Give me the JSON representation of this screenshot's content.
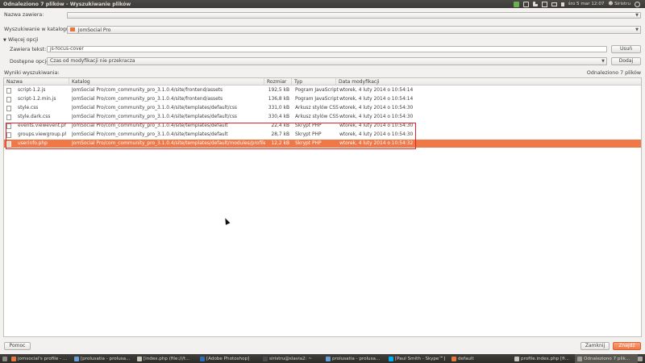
{
  "window": {
    "title": "Odnaleziono 7 plików - Wyszukiwanie plików"
  },
  "tray": {
    "clock": "śro 5 mar 12:07",
    "user": "Siristru"
  },
  "search": {
    "name_label": "Nazwa zawiera:",
    "name_value": "",
    "folder_label": "Wyszukiwanie w katalogu:",
    "folder_value": "JomSocial Pro",
    "more_options": "Więcej opcji"
  },
  "options": {
    "contains_text_label": "Zawiera tekst:",
    "contains_text_value": "js-focus-cover",
    "remove_button": "Usuń",
    "available_label": "Dostępne opcje:",
    "available_value": "Czas od modyfikacji nie przekracza",
    "add_button": "Dodaj"
  },
  "results": {
    "label": "Wyniki wyszukiwania:",
    "count": "Odnaleziono 7 plików",
    "columns": [
      "Nazwa",
      "Katalog",
      "Rozmiar",
      "Typ",
      "Data modyfikacji"
    ],
    "rows": [
      {
        "name": "script-1.2.js",
        "folder": "JomSocial Pro/com_community_pro_3.1.0.4/site/frontend/assets",
        "size": "192,5 kB",
        "type": "Pogram JavaScript",
        "date": "wtorek, 4 luty 2014 o 10:54:14",
        "selected": false
      },
      {
        "name": "script-1.2.min.js",
        "folder": "JomSocial Pro/com_community_pro_3.1.0.4/site/frontend/assets",
        "size": "136,8 kB",
        "type": "Pogram JavaScript",
        "date": "wtorek, 4 luty 2014 o 10:54:14",
        "selected": false
      },
      {
        "name": "style.css",
        "folder": "JomSocial Pro/com_community_pro_3.1.0.4/site/templates/default/css",
        "size": "331,0 kB",
        "type": "Arkusz stylów CSS",
        "date": "wtorek, 4 luty 2014 o 10:54:30",
        "selected": false
      },
      {
        "name": "style.dark.css",
        "folder": "JomSocial Pro/com_community_pro_3.1.0.4/site/templates/default/css",
        "size": "330,4 kB",
        "type": "Arkusz stylów CSS",
        "date": "wtorek, 4 luty 2014 o 10:54:30",
        "selected": false
      },
      {
        "name": "events.viewevent.php",
        "folder": "JomSocial Pro/com_community_pro_3.1.0.4/site/templates/default",
        "size": "22,4 kB",
        "type": "Skrypt PHP",
        "date": "wtorek, 4 luty 2014 o 10:54:30",
        "selected": false
      },
      {
        "name": "groups.viewgroup.php",
        "folder": "JomSocial Pro/com_community_pro_3.1.0.4/site/templates/default",
        "size": "28,7 kB",
        "type": "Skrypt PHP",
        "date": "wtorek, 4 luty 2014 o 10:54:30",
        "selected": false
      },
      {
        "name": "userinfo.php",
        "folder": "JomSocial Pro/com_community_pro_3.1.0.4/site/templates/default/modules/profile",
        "size": "12,2 kB",
        "type": "Skrypt PHP",
        "date": "wtorek, 4 luty 2014 o 10:54:32",
        "selected": true
      }
    ]
  },
  "footer": {
    "help_button": "Pomoc",
    "close_button": "Zamknij",
    "find_button": "Znajdź"
  },
  "taskbar": {
    "items": [
      {
        "label": "jomsocial's profile - ..."
      },
      {
        "label": "[prolusatia - prolusa..."
      },
      {
        "label": "[index.php (file:///t..."
      },
      {
        "label": "[Adobe Photoshop]"
      },
      {
        "label": "siristru@slavia2: ~"
      },
      {
        "label": "prolusatia - prolusa..."
      },
      {
        "label": "[Paul Smith - Skype™]"
      },
      {
        "label": "default"
      },
      {
        "label": "profile.index.php [fi..."
      },
      {
        "label": "Odnaleziono 7 plik..."
      }
    ]
  },
  "colors": {
    "selection": "#f07746",
    "highlight_box": "#e0262c",
    "panel": "#3c3b37",
    "find_button": "#f07746"
  }
}
